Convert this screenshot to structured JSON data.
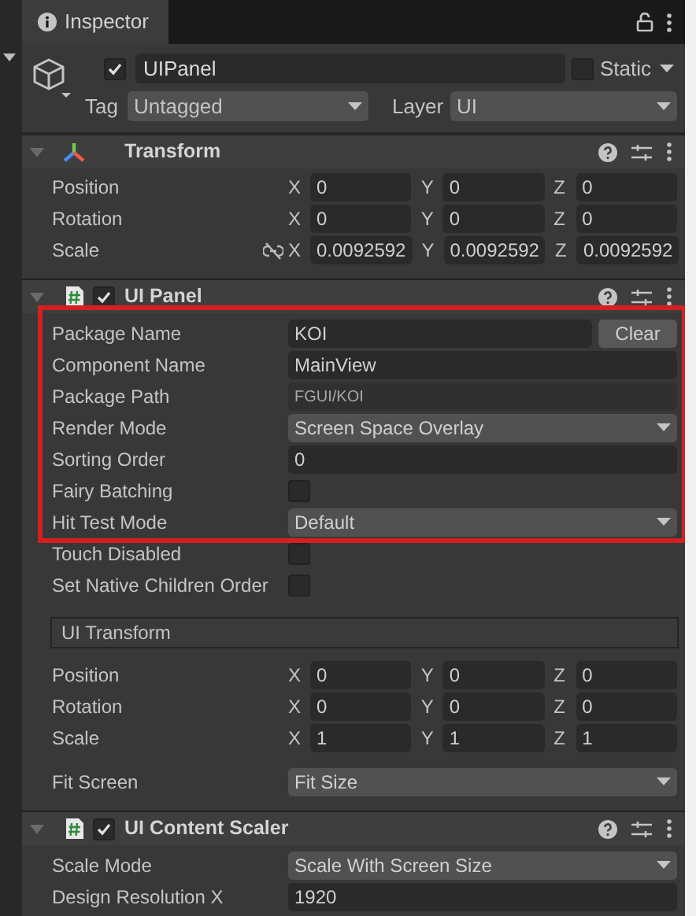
{
  "tab": {
    "title": "Inspector"
  },
  "object": {
    "active": true,
    "name": "UIPanel",
    "static": false,
    "static_label": "Static",
    "tag_label": "Tag",
    "tag": "Untagged",
    "layer_label": "Layer",
    "layer": "UI"
  },
  "components": [
    {
      "kind": "transform",
      "title": "Transform",
      "expanded": true,
      "rows": [
        {
          "kind": "vector3",
          "label": "Position",
          "values": [
            {
              "axis": "X",
              "value": "0"
            },
            {
              "axis": "Y",
              "value": "0"
            },
            {
              "axis": "Z",
              "value": "0"
            }
          ]
        },
        {
          "kind": "vector3",
          "label": "Rotation",
          "values": [
            {
              "axis": "X",
              "value": "0"
            },
            {
              "axis": "Y",
              "value": "0"
            },
            {
              "axis": "Z",
              "value": "0"
            }
          ]
        },
        {
          "kind": "vector3",
          "label": "Scale",
          "proportional": false,
          "values": [
            {
              "axis": "X",
              "value": "0.0092592"
            },
            {
              "axis": "Y",
              "value": "0.0092592"
            },
            {
              "axis": "Z",
              "value": "0.0092592"
            }
          ]
        }
      ]
    },
    {
      "kind": "script",
      "title": "UI Panel",
      "expanded": true,
      "enabled": true,
      "highlighted_rows": [
        {
          "kind": "text",
          "label": "Package Name",
          "value": "KOI",
          "button": "Clear"
        },
        {
          "kind": "text",
          "label": "Component Name",
          "value": "MainView"
        },
        {
          "kind": "readonly",
          "label": "Package Path",
          "value": "FGUI/KOI"
        },
        {
          "kind": "dropdown",
          "label": "Render Mode",
          "value": "Screen Space Overlay"
        },
        {
          "kind": "text",
          "label": "Sorting Order",
          "value": "0"
        },
        {
          "kind": "checkbox",
          "label": "Fairy Batching",
          "checked": false
        },
        {
          "kind": "dropdown",
          "label": "Hit Test Mode",
          "value": "Default"
        }
      ],
      "rows": [
        {
          "kind": "checkbox",
          "label": "Touch Disabled",
          "checked": false
        },
        {
          "kind": "checkbox",
          "label": "Set Native Children Order",
          "checked": false
        },
        {
          "kind": "section",
          "label": "UI Transform"
        },
        {
          "kind": "vector3",
          "label": "Position",
          "values": [
            {
              "axis": "X",
              "value": "0"
            },
            {
              "axis": "Y",
              "value": "0"
            },
            {
              "axis": "Z",
              "value": "0"
            }
          ]
        },
        {
          "kind": "vector3",
          "label": "Rotation",
          "values": [
            {
              "axis": "X",
              "value": "0"
            },
            {
              "axis": "Y",
              "value": "0"
            },
            {
              "axis": "Z",
              "value": "0"
            }
          ]
        },
        {
          "kind": "vector3",
          "label": "Scale",
          "values": [
            {
              "axis": "X",
              "value": "1"
            },
            {
              "axis": "Y",
              "value": "1"
            },
            {
              "axis": "Z",
              "value": "1"
            }
          ]
        },
        {
          "kind": "dropdown",
          "label": "Fit Screen",
          "value": "Fit Size"
        }
      ]
    },
    {
      "kind": "script",
      "title": "UI Content Scaler",
      "expanded": true,
      "enabled": true,
      "rows": [
        {
          "kind": "dropdown",
          "label": "Scale Mode",
          "value": "Scale With Screen Size"
        },
        {
          "kind": "text",
          "label": "Design Resolution X",
          "value": "1920"
        }
      ]
    }
  ]
}
